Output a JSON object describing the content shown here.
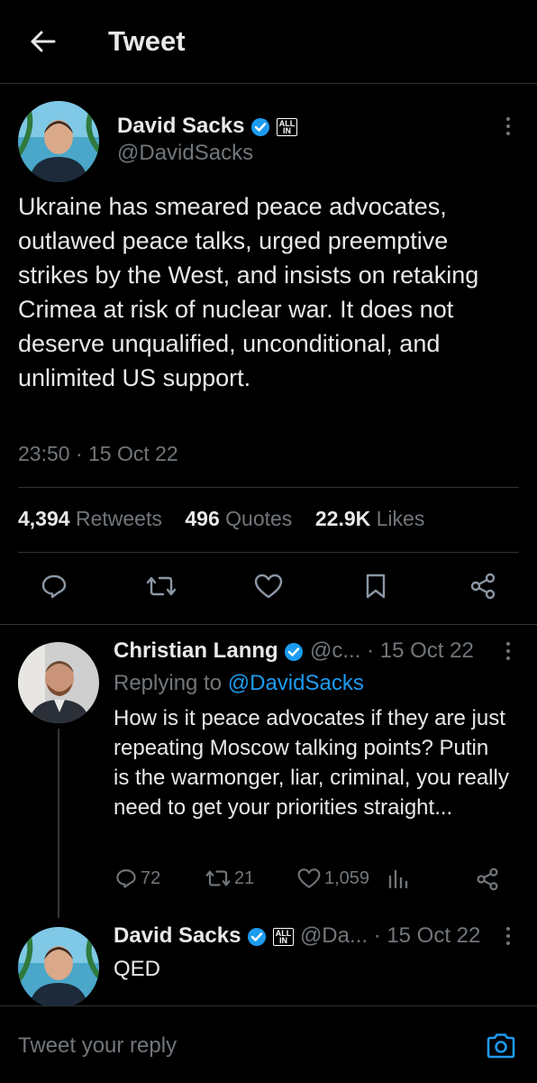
{
  "header": {
    "title": "Tweet"
  },
  "tweet": {
    "author_name": "David Sacks",
    "handle": "@DavidSacks",
    "badge_text_top": "ALL",
    "badge_text_bottom": "IN",
    "text": "Ukraine has smeared peace advocates, outlawed peace talks, urged preemptive strikes by the West, and insists on retaking Crimea at risk of nuclear war. It does not deserve unqualified, unconditional, and unlimited US support.",
    "timestamp": "23:50 · 15 Oct 22",
    "retweets": "4,394",
    "retweets_label": "Retweets",
    "quotes": "496",
    "quotes_label": "Quotes",
    "likes": "22.9K",
    "likes_label": "Likes"
  },
  "reply1": {
    "author_name": "Christian Lanng",
    "handle": "@c...",
    "date": "· 15 Oct 22",
    "replying_label": "Replying to",
    "replying_handle": "@DavidSacks",
    "text": "How is it peace advocates if they are just repeating Moscow talking points? Putin is the warmonger, liar, criminal, you really need to get your priorities straight...",
    "replies": "72",
    "retweets": "21",
    "likes": "1,059"
  },
  "reply2": {
    "author_name": "David Sacks",
    "handle": "@Da...",
    "date": "· 15 Oct 22",
    "badge_text_top": "ALL",
    "badge_text_bottom": "IN",
    "text": "QED"
  },
  "composer": {
    "placeholder": "Tweet your reply"
  },
  "colors": {
    "accent": "#1d9bf0",
    "muted": "#71767b",
    "text": "#e7e9ea",
    "background": "#000000"
  }
}
